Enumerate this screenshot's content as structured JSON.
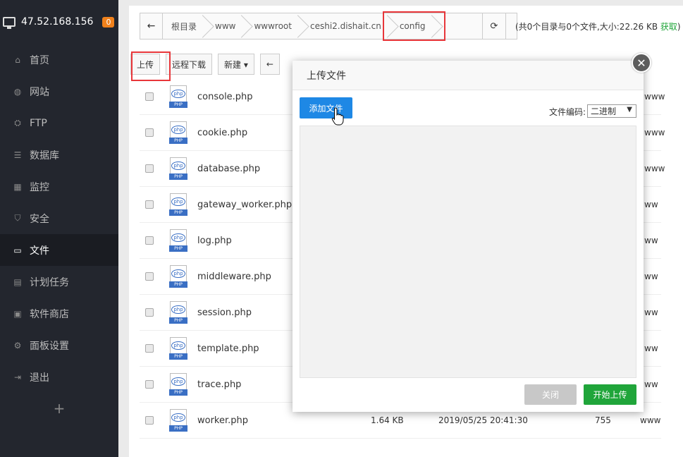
{
  "sidebar": {
    "server_ip": "47.52.168.156",
    "badge": "0",
    "items": [
      {
        "label": "首页",
        "icon": "home-icon",
        "glyph": "⌂"
      },
      {
        "label": "网站",
        "icon": "globe-icon",
        "glyph": "◍"
      },
      {
        "label": "FTP",
        "icon": "ftp-icon",
        "glyph": "⛭"
      },
      {
        "label": "数据库",
        "icon": "database-icon",
        "glyph": "☰"
      },
      {
        "label": "监控",
        "icon": "monitor-icon",
        "glyph": "▦"
      },
      {
        "label": "安全",
        "icon": "shield-icon",
        "glyph": "⛉"
      },
      {
        "label": "文件",
        "icon": "folder-icon",
        "glyph": "▭"
      },
      {
        "label": "计划任务",
        "icon": "calendar-icon",
        "glyph": "▤"
      },
      {
        "label": "软件商店",
        "icon": "apps-icon",
        "glyph": "▣"
      },
      {
        "label": "面板设置",
        "icon": "gear-icon",
        "glyph": "⚙"
      },
      {
        "label": "退出",
        "icon": "logout-icon",
        "glyph": "⇥"
      }
    ],
    "plus": "+"
  },
  "pathbar": {
    "crumbs": [
      "根目录",
      "www",
      "wwwroot",
      "ceshi2.dishait.cn",
      "config"
    ],
    "stats_prefix": "(共0个目录与0个文件,大小:22.26 KB ",
    "stats_fetch": "获取",
    "stats_suffix": ")"
  },
  "toolbar": {
    "upload": "上传",
    "remote_download": "远程下载",
    "new": "新建 ▾"
  },
  "files": [
    {
      "name": "console.php",
      "size": "",
      "date": "",
      "perm": "",
      "owner": "www"
    },
    {
      "name": "cookie.php",
      "size": "",
      "date": "",
      "perm": "",
      "owner": "www"
    },
    {
      "name": "database.php",
      "size": "",
      "date": "",
      "perm": "",
      "owner": "www"
    },
    {
      "name": "gateway_worker.php",
      "size": "",
      "date": "",
      "perm": "",
      "owner": "ww"
    },
    {
      "name": "log.php",
      "size": "",
      "date": "",
      "perm": "",
      "owner": "ww"
    },
    {
      "name": "middleware.php",
      "size": "",
      "date": "",
      "perm": "",
      "owner": "ww"
    },
    {
      "name": "session.php",
      "size": "",
      "date": "",
      "perm": "",
      "owner": "ww"
    },
    {
      "name": "template.php",
      "size": "",
      "date": "",
      "perm": "",
      "owner": "ww"
    },
    {
      "name": "trace.php",
      "size": "",
      "date": "",
      "perm": "",
      "owner": "ww"
    },
    {
      "name": "worker.php",
      "size": "1.64 KB",
      "date": "2019/05/25 20:41:30",
      "perm": "755",
      "owner": "www"
    }
  ],
  "php_icon": {
    "top": "php",
    "tag": "PHP"
  },
  "modal": {
    "title": "上传文件",
    "add_file": "添加文件",
    "encoding_label": "文件编码:",
    "encoding_value": "二进制",
    "close": "关闭",
    "start_upload": "开始上传",
    "close_x": "✕"
  },
  "colors": {
    "sidebar_bg": "#23262e",
    "accent_blue": "#1e88e5",
    "accent_green": "#20a53a",
    "highlight_red": "#e8363a",
    "badge_orange": "#f0811c"
  }
}
